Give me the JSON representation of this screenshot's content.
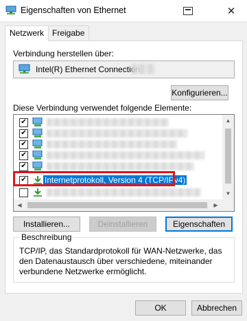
{
  "window": {
    "title": "Eigenschaften von Ethernet",
    "close_glyph": "✕"
  },
  "tabs": [
    {
      "label": "Netzwerk",
      "active": true
    },
    {
      "label": "Freigabe",
      "active": false
    }
  ],
  "connect_using": {
    "label": "Verbindung herstellen über:",
    "adapter_name": "Intel(R) Ethernet Connection",
    "adapter_icon": "network-adapter-icon"
  },
  "buttons": {
    "configure": "Konfigurieren...",
    "install": "Installieren...",
    "uninstall": "Deinstallieren",
    "properties": "Eigenschaften",
    "ok": "OK",
    "cancel": "Abbrechen"
  },
  "items_label": "Diese Verbindung verwendet folgende Elemente:",
  "items": [
    {
      "checked": true,
      "icon": "client-icon",
      "label": ""
    },
    {
      "checked": true,
      "icon": "service-icon",
      "label": ""
    },
    {
      "checked": true,
      "icon": "service-icon",
      "label": ""
    },
    {
      "checked": true,
      "icon": "protocol-icon",
      "label": ""
    },
    {
      "checked": true,
      "icon": "protocol-icon",
      "label": ""
    },
    {
      "checked": true,
      "icon": "protocol-icon",
      "label": "Internetprotokoll, Version 4 (TCP/IPv4)",
      "selected": true
    },
    {
      "checked": false,
      "icon": "protocol-icon",
      "label": ""
    }
  ],
  "description": {
    "title": "Beschreibung",
    "text": "TCP/IP, das Standardprotokoll für WAN-Netzwerke, das den Datenaustausch über verschiedene, miteinander verbundene Netzwerke ermöglicht."
  },
  "colors": {
    "selection": "#0078d7",
    "annotation_red": "#e0141d"
  }
}
